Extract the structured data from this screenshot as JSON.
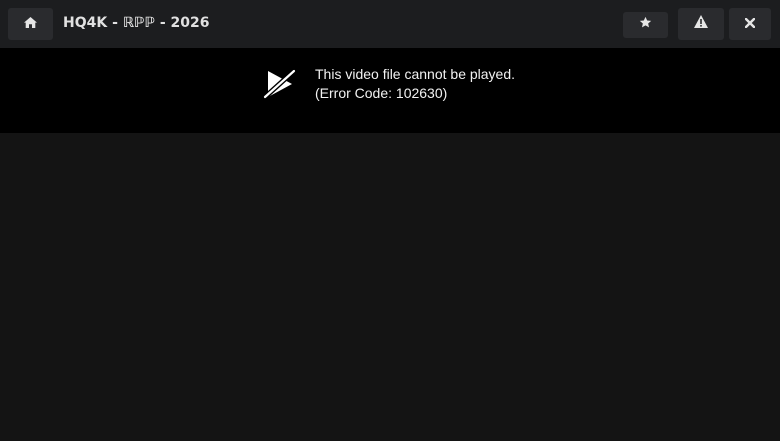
{
  "header": {
    "title": "HQ4K - ℝℙℙ - 2026",
    "buttons": {
      "home_icon": "home-icon",
      "favorite_icon": "star-icon",
      "report_icon": "warning-icon",
      "close_icon": "close-icon"
    }
  },
  "player": {
    "error_icon": "video-off-icon",
    "error_message": "This video file cannot be played.",
    "error_code": "(Error Code: 102630)"
  },
  "colors": {
    "topbar": "#1c1d1f",
    "button": "#2a2b2e",
    "player_bg": "#000000",
    "page_bg": "#141414",
    "text": "#f2f2f2"
  }
}
